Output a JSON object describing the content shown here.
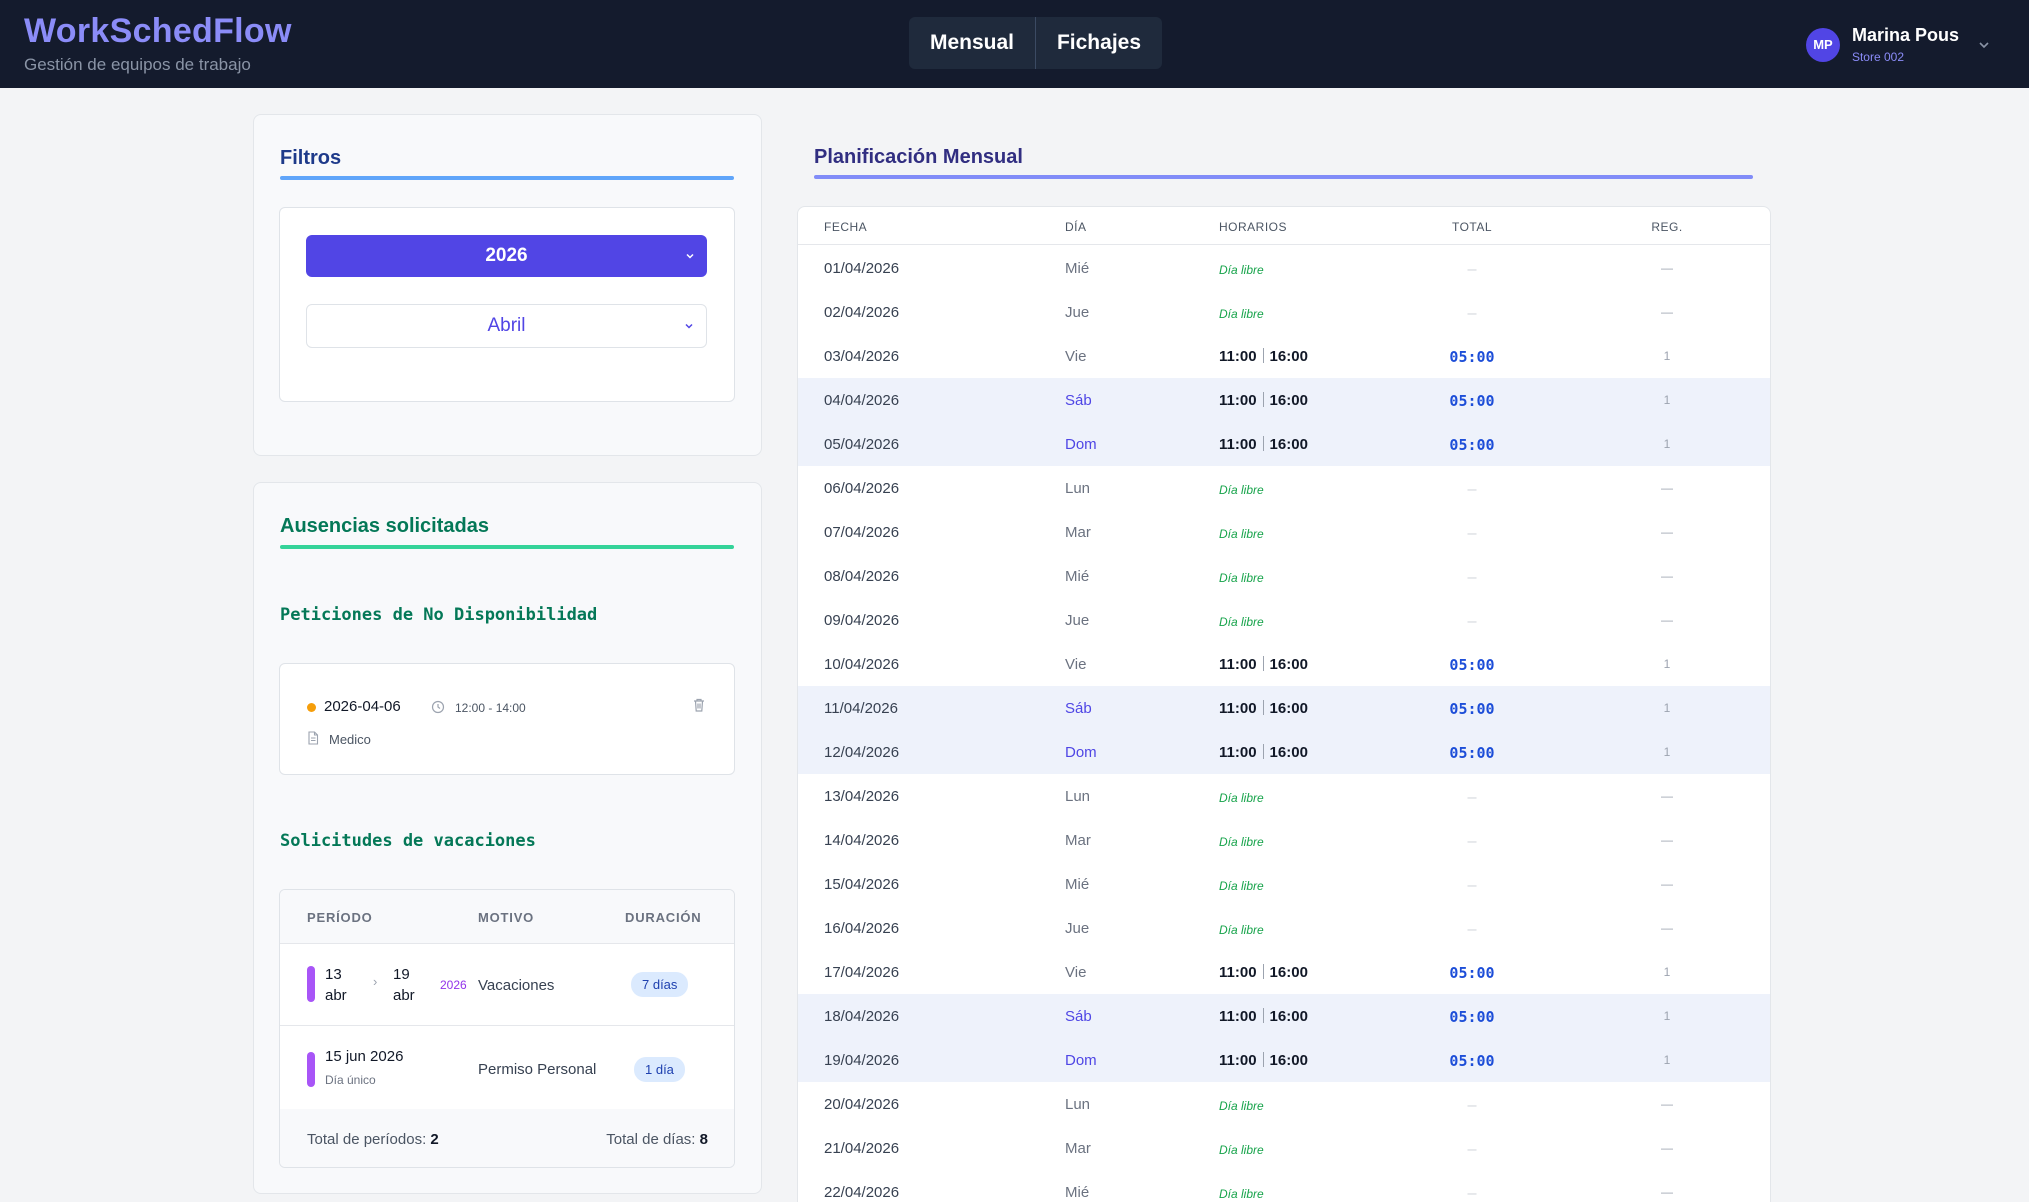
{
  "header": {
    "title": "WorkSchedFlow",
    "subtitle": "Gestión de equipos de trabajo",
    "tabs": [
      "Mensual",
      "Fichajes"
    ],
    "user": {
      "initials": "MP",
      "name": "Marina Pous",
      "store": "Store 002"
    }
  },
  "filters": {
    "title": "Filtros",
    "year": "2026",
    "month": "Abril"
  },
  "absences": {
    "title": "Ausencias solicitadas",
    "unavailability_title": "Peticiones de No Disponibilidad",
    "unavailability": {
      "date": "2026-04-06",
      "time": "12:00 - 14:00",
      "reason": "Medico"
    },
    "vacations_title": "Solicitudes de vacaciones",
    "vacation_headers": {
      "period": "PERÍODO",
      "reason": "MOTIVO",
      "duration": "DURACIÓN"
    },
    "vacations": [
      {
        "start_day": "13",
        "start_month": "abr",
        "end_day": "19",
        "end_month": "abr",
        "year": "2026",
        "reason": "Vacaciones",
        "duration": "7 días"
      },
      {
        "single_date": "15 jun 2026",
        "single_note": "Día único",
        "reason": "Permiso Personal",
        "duration": "1 día"
      }
    ],
    "totals": {
      "periods_label": "Total de períodos:",
      "periods": "2",
      "days_label": "Total de días:",
      "days": "8"
    }
  },
  "monthly": {
    "title": "Planificación Mensual",
    "headers": {
      "date": "FECHA",
      "day": "DÍA",
      "schedule": "HORARIOS",
      "total": "TOTAL",
      "reg": "REG."
    },
    "free_label": "Día libre",
    "dash": "—",
    "rows": [
      {
        "date": "01/04/2026",
        "day": "Mié",
        "free": true
      },
      {
        "date": "02/04/2026",
        "day": "Jue",
        "free": true
      },
      {
        "date": "03/04/2026",
        "day": "Vie",
        "start": "11:00",
        "end": "16:00",
        "total": "05:00",
        "reg": "1"
      },
      {
        "date": "04/04/2026",
        "day": "Sáb",
        "start": "11:00",
        "end": "16:00",
        "total": "05:00",
        "reg": "1",
        "weekend": true
      },
      {
        "date": "05/04/2026",
        "day": "Dom",
        "start": "11:00",
        "end": "16:00",
        "total": "05:00",
        "reg": "1",
        "weekend": true
      },
      {
        "date": "06/04/2026",
        "day": "Lun",
        "free": true
      },
      {
        "date": "07/04/2026",
        "day": "Mar",
        "free": true
      },
      {
        "date": "08/04/2026",
        "day": "Mié",
        "free": true
      },
      {
        "date": "09/04/2026",
        "day": "Jue",
        "free": true
      },
      {
        "date": "10/04/2026",
        "day": "Vie",
        "start": "11:00",
        "end": "16:00",
        "total": "05:00",
        "reg": "1"
      },
      {
        "date": "11/04/2026",
        "day": "Sáb",
        "start": "11:00",
        "end": "16:00",
        "total": "05:00",
        "reg": "1",
        "weekend": true
      },
      {
        "date": "12/04/2026",
        "day": "Dom",
        "start": "11:00",
        "end": "16:00",
        "total": "05:00",
        "reg": "1",
        "weekend": true
      },
      {
        "date": "13/04/2026",
        "day": "Lun",
        "free": true
      },
      {
        "date": "14/04/2026",
        "day": "Mar",
        "free": true
      },
      {
        "date": "15/04/2026",
        "day": "Mié",
        "free": true
      },
      {
        "date": "16/04/2026",
        "day": "Jue",
        "free": true
      },
      {
        "date": "17/04/2026",
        "day": "Vie",
        "start": "11:00",
        "end": "16:00",
        "total": "05:00",
        "reg": "1"
      },
      {
        "date": "18/04/2026",
        "day": "Sáb",
        "start": "11:00",
        "end": "16:00",
        "total": "05:00",
        "reg": "1",
        "weekend": true
      },
      {
        "date": "19/04/2026",
        "day": "Dom",
        "start": "11:00",
        "end": "16:00",
        "total": "05:00",
        "reg": "1",
        "weekend": true
      },
      {
        "date": "20/04/2026",
        "day": "Lun",
        "free": true
      },
      {
        "date": "21/04/2026",
        "day": "Mar",
        "free": true
      },
      {
        "date": "22/04/2026",
        "day": "Mié",
        "free": true
      }
    ]
  }
}
